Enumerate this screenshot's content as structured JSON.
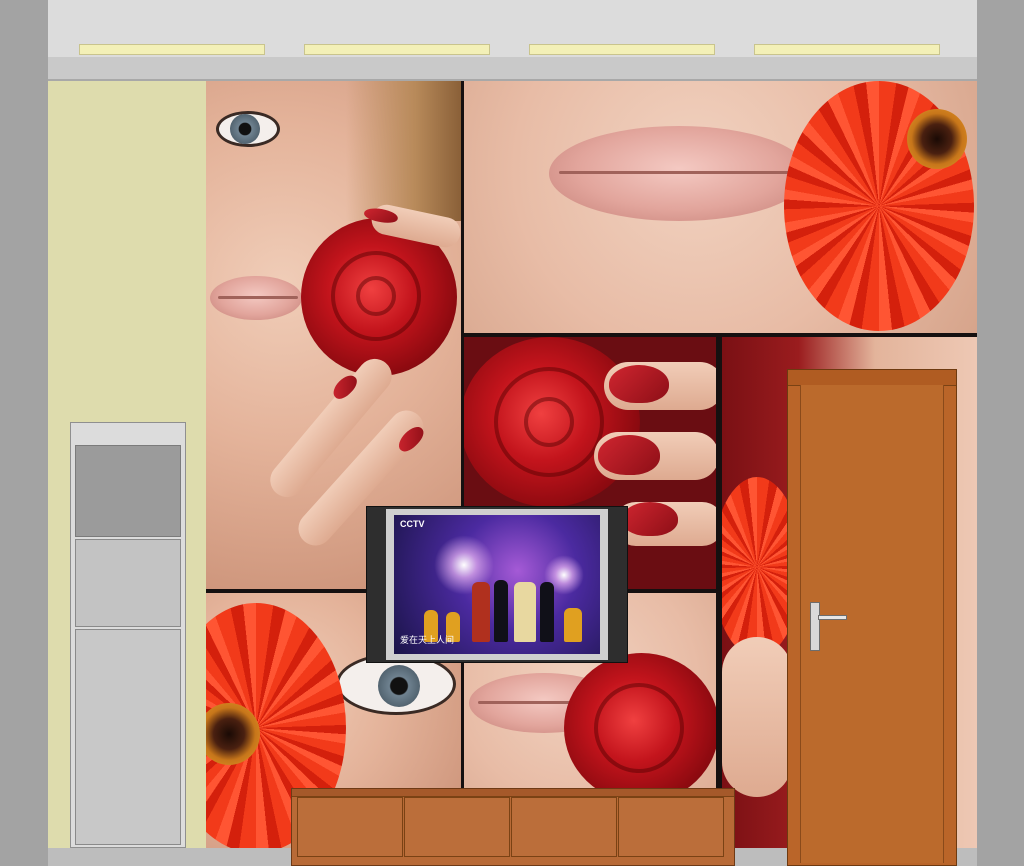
{
  "scene": {
    "type": "interior wall elevation rendering",
    "colors": {
      "wall_left": "#dedcad",
      "ceiling": "#dcdcdc",
      "door": "#ba6529",
      "stand": "#b86a36",
      "rose": "#c3141c",
      "gerbera": "#f23a1a"
    }
  },
  "tv": {
    "logo": "CCTV",
    "caption": "爱在天上人间"
  },
  "icons": {
    "door_handle": "door-handle-icon"
  }
}
